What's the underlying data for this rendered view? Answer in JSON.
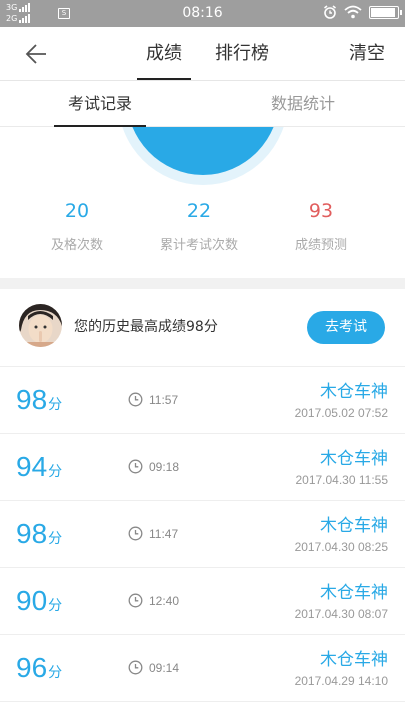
{
  "status_bar": {
    "net1": "3G",
    "net2": "2G",
    "sim_icon_label": "S",
    "time": "08:16",
    "icons": [
      "alarm-icon",
      "wifi-icon",
      "battery-icon"
    ]
  },
  "nav": {
    "tabs": [
      {
        "label": "成绩",
        "active": true
      },
      {
        "label": "排行榜",
        "active": false
      }
    ],
    "clear_label": "清空"
  },
  "sub_tabs": [
    {
      "label": "考试记录",
      "active": true
    },
    {
      "label": "数据统计",
      "active": false
    }
  ],
  "stats": [
    {
      "value": "20",
      "label": "及格次数",
      "color": "#29a9e6"
    },
    {
      "value": "22",
      "label": "累计考试次数",
      "color": "#29a9e6"
    },
    {
      "value": "93",
      "label": "成绩预测",
      "color": "#e15d5d"
    }
  ],
  "best": {
    "text": "您的历史最高成绩98分",
    "button_label": "去考试"
  },
  "records": [
    {
      "score": "98",
      "unit": "分",
      "time": "11:57",
      "mode": "木仓车神",
      "date": "2017.05.02  07:52"
    },
    {
      "score": "94",
      "unit": "分",
      "time": "09:18",
      "mode": "木仓车神",
      "date": "2017.04.30  11:55"
    },
    {
      "score": "98",
      "unit": "分",
      "time": "11:47",
      "mode": "木仓车神",
      "date": "2017.04.30  08:25"
    },
    {
      "score": "90",
      "unit": "分",
      "time": "12:40",
      "mode": "木仓车神",
      "date": "2017.04.30  08:07"
    },
    {
      "score": "96",
      "unit": "分",
      "time": "09:14",
      "mode": "木仓车神",
      "date": "2017.04.29  14:10"
    }
  ],
  "colors": {
    "accent": "#29a9e6",
    "danger": "#e15d5d"
  }
}
